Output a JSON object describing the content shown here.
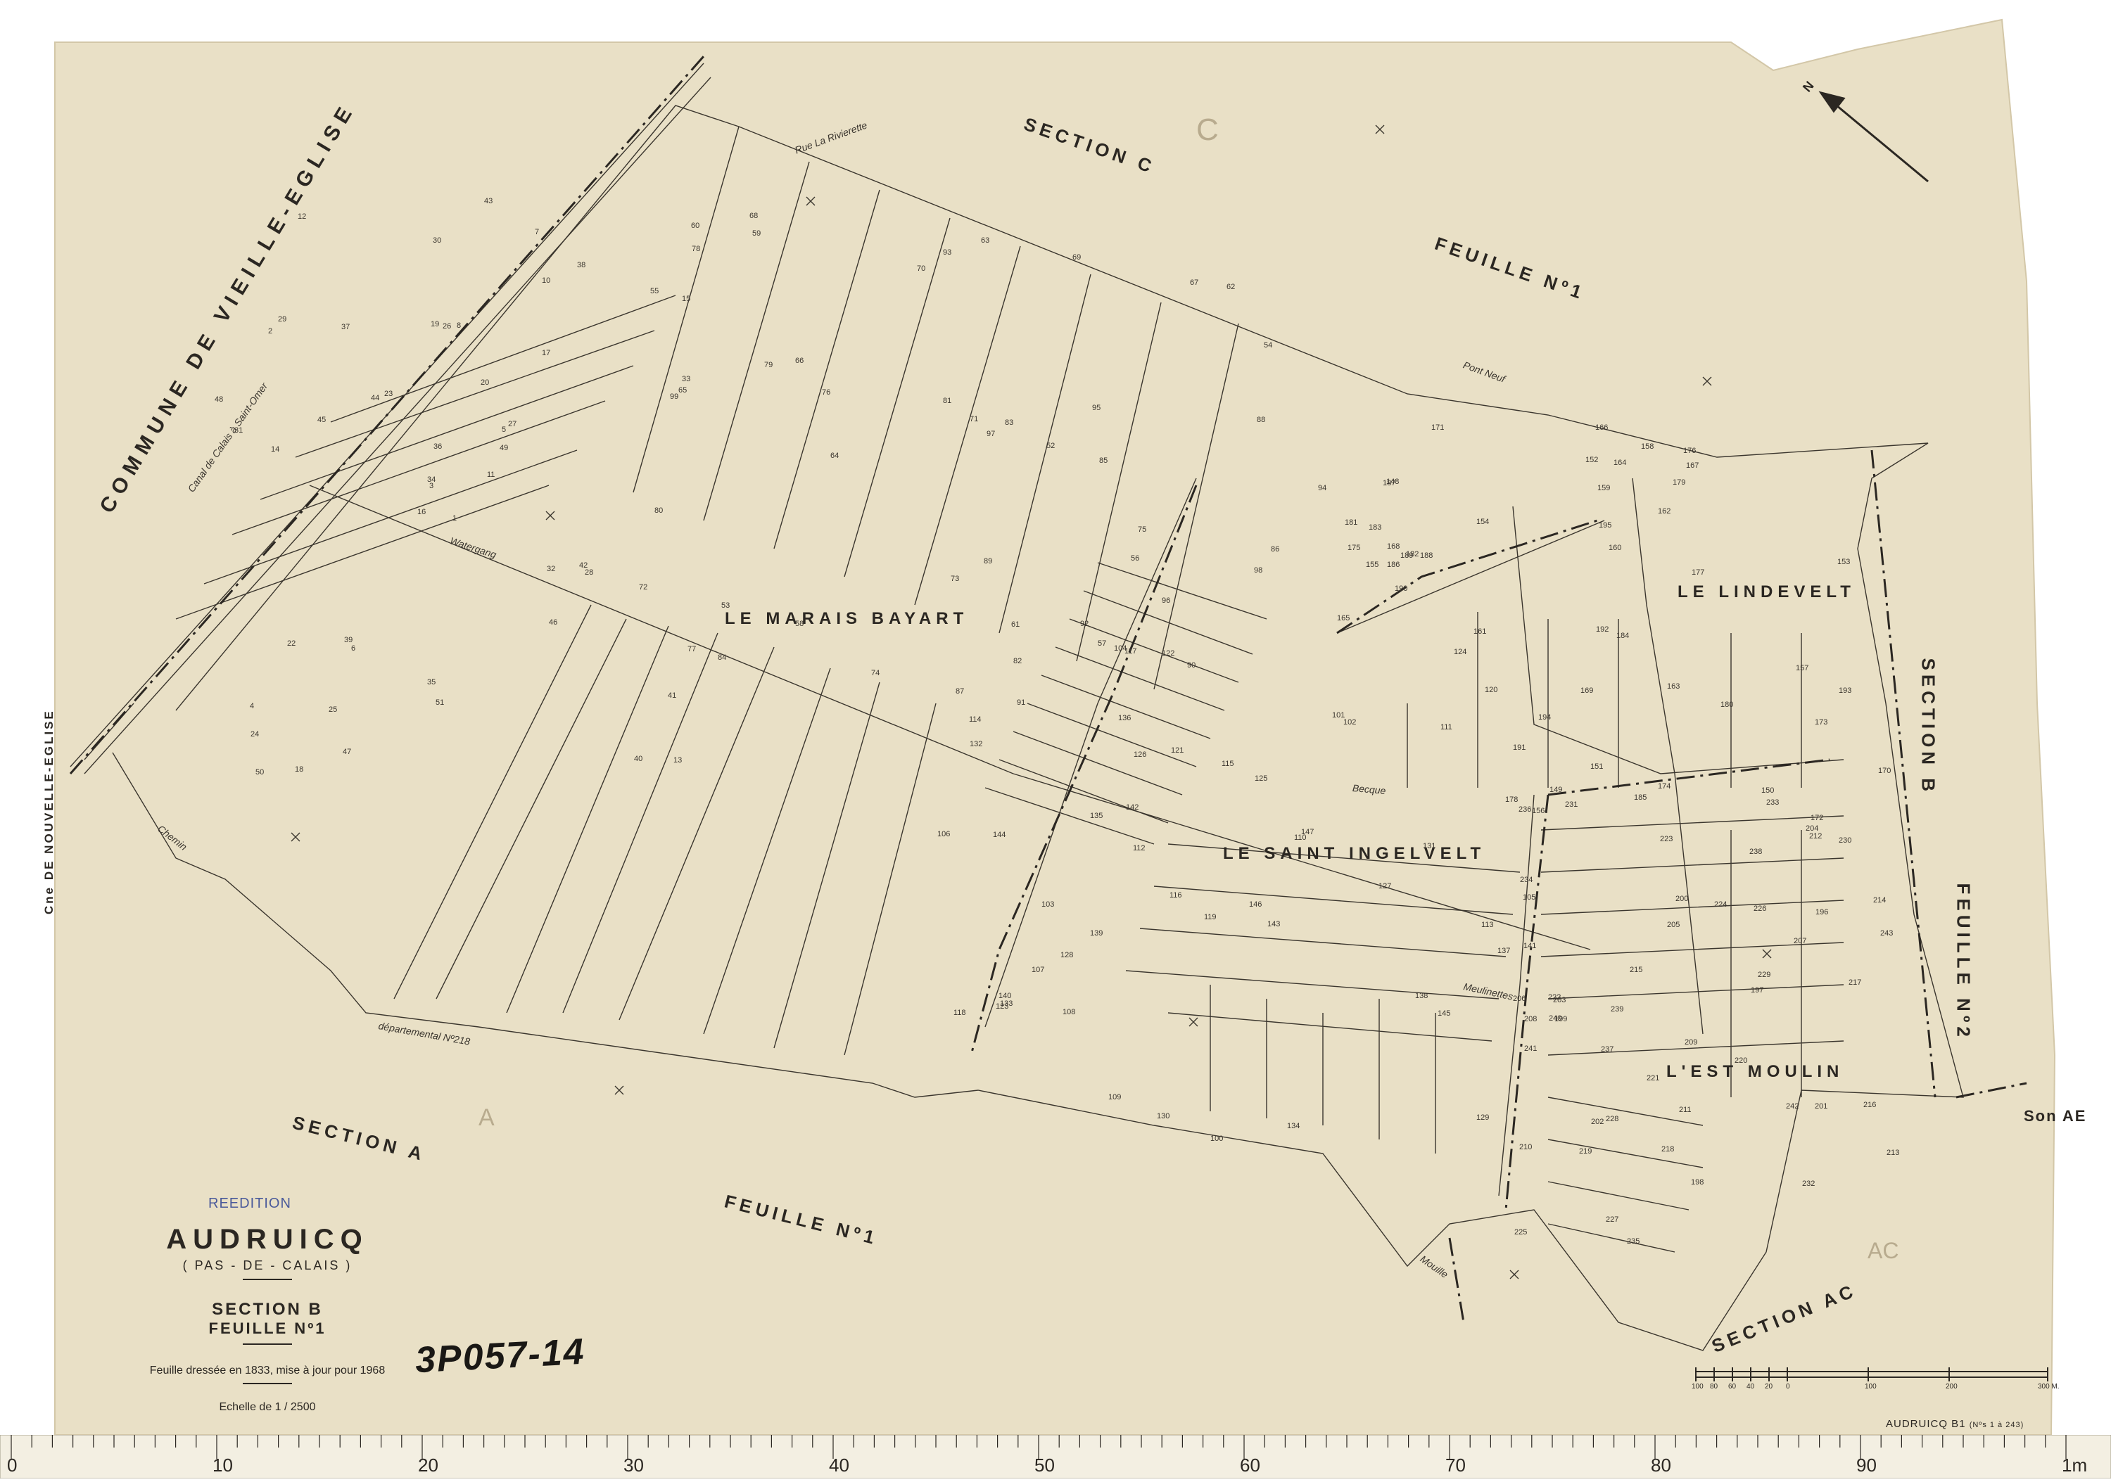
{
  "map": {
    "commune": "AUDRUICQ",
    "department": "( PAS - DE - CALAIS )",
    "section": "SECTION B",
    "sheet": "FEUILLE Nº1",
    "drawn_note": "Feuille dressée en 1833, mise à jour pour 1968",
    "scale": "Echelle de 1 / 2500",
    "stamp": "REEDITION",
    "archive_ref": "3P057-14",
    "footer_ref": "AUDRUICQ B1",
    "footer_ref_small": "(Nºs 1 à 243)"
  },
  "neighbours": {
    "commune_vieille_eglise": "COMMUNE DE VIEILLE-EGLISE",
    "commune_nouvelle_eglise": "Cne DE NOUVELLE-EGLISE",
    "section_c": "SECTION C",
    "feuille_c": "FEUILLE Nº1",
    "section_a": "SECTION A",
    "feuille_a": "FEUILLE Nº1",
    "section_b2": "SECTION B",
    "feuille_b2": "FEUILLE Nº2",
    "section_ac": "SECTION AC",
    "section_ae": "Son AE",
    "pencil_c": "C",
    "pencil_a": "A",
    "pencil_ac": "AC"
  },
  "localities": [
    "LE MARAIS BAYART",
    "LE LINDEVELT",
    "LE SAINT INGELVELT",
    "L'EST MOULIN"
  ],
  "roads": {
    "canal": "Canal de Calais à Saint-Omer",
    "rue_riviere": "Rue La Rivierette",
    "watergang": "Watergang",
    "chemin": "Chemin",
    "route_dep": "départemental Nº218",
    "mouille": "Mouille",
    "becque": "Becque",
    "pont_neuf": "Pont Neuf",
    "meulinettes": "Meulinettes"
  },
  "parcels": [
    "1",
    "2",
    "3",
    "4",
    "5",
    "6",
    "7",
    "8",
    "10",
    "11",
    "12",
    "13",
    "14",
    "15",
    "16",
    "17",
    "18",
    "19",
    "20",
    "22",
    "23",
    "24",
    "25",
    "26",
    "27",
    "28",
    "29",
    "30",
    "31",
    "32",
    "33",
    "34",
    "35",
    "36",
    "37",
    "38",
    "39",
    "40",
    "41",
    "42",
    "43",
    "44",
    "45",
    "46",
    "47",
    "48",
    "49",
    "50",
    "51",
    "52",
    "53",
    "54",
    "55",
    "56",
    "57",
    "58",
    "59",
    "60",
    "61",
    "62",
    "63",
    "64",
    "65",
    "66",
    "67",
    "68",
    "69",
    "70",
    "71",
    "72",
    "73",
    "74",
    "75",
    "76",
    "77",
    "78",
    "79",
    "80",
    "81",
    "82",
    "83",
    "84",
    "85",
    "86",
    "87",
    "88",
    "89",
    "90",
    "91",
    "92",
    "93",
    "94",
    "95",
    "96",
    "97",
    "98",
    "99",
    "100",
    "101",
    "102",
    "103",
    "104",
    "105",
    "106",
    "107",
    "108",
    "109",
    "110",
    "111",
    "112",
    "113",
    "114",
    "115",
    "116",
    "117",
    "118",
    "119",
    "120",
    "121",
    "122",
    "123",
    "124",
    "125",
    "126",
    "127",
    "128",
    "129",
    "130",
    "131",
    "132",
    "133",
    "134",
    "135",
    "136",
    "137",
    "138",
    "139",
    "140",
    "141",
    "142",
    "143",
    "144",
    "145",
    "146",
    "147",
    "148",
    "149",
    "150",
    "151",
    "152",
    "153",
    "154",
    "155",
    "156",
    "157",
    "158",
    "159",
    "160",
    "161",
    "162",
    "163",
    "164",
    "165",
    "166",
    "167",
    "168",
    "169",
    "170",
    "171",
    "172",
    "173",
    "174",
    "175",
    "176",
    "177",
    "178",
    "179",
    "180",
    "181",
    "182",
    "183",
    "184",
    "185",
    "186",
    "187",
    "188",
    "189",
    "190",
    "191",
    "192",
    "193",
    "194",
    "195",
    "196",
    "197",
    "198",
    "199",
    "200",
    "201",
    "202",
    "203",
    "204",
    "205",
    "206",
    "207",
    "208",
    "209",
    "210",
    "211",
    "212",
    "213",
    "214",
    "215",
    "216",
    "217",
    "218",
    "219",
    "220",
    "221",
    "222",
    "223",
    "224",
    "225",
    "226",
    "227",
    "228",
    "229",
    "230",
    "231",
    "232",
    "233",
    "234",
    "235",
    "236",
    "237",
    "238",
    "239",
    "240",
    "241",
    "242",
    "243"
  ],
  "scale_bar": {
    "ticks": [
      "100",
      "80",
      "60",
      "40",
      "20",
      "0",
      "100",
      "200",
      "300 M."
    ]
  },
  "ruler_labels": [
    "0",
    "10",
    "20",
    "30",
    "40",
    "50",
    "60",
    "70",
    "80",
    "90",
    "1m"
  ],
  "north": "N",
  "colors": {
    "paper": "#e9e0c6",
    "paper_edge": "#d8cdb0",
    "ink": "#2b2722",
    "ruler": "#f3efe2"
  }
}
